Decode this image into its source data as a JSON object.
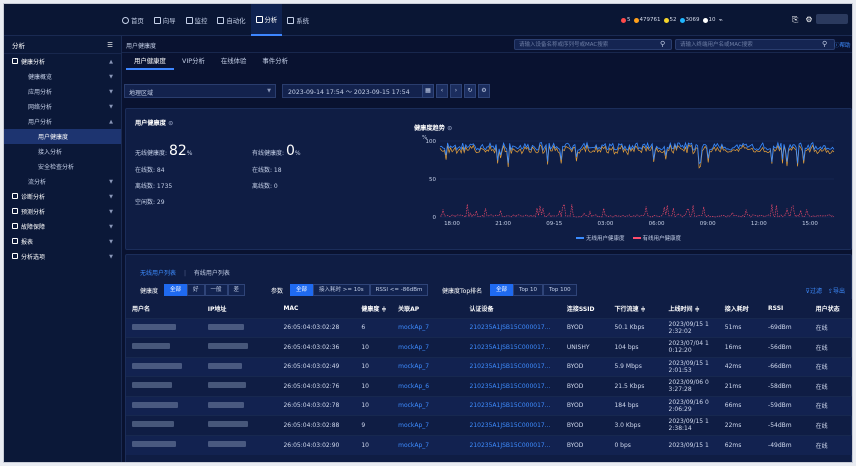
{
  "top_nav": [
    {
      "label": "首页",
      "icon": "home-icon"
    },
    {
      "label": "向导",
      "icon": "compass-icon"
    },
    {
      "label": "监控",
      "icon": "monitor-icon"
    },
    {
      "label": "自动化",
      "icon": "automation-icon"
    },
    {
      "label": "分析",
      "icon": "analysis-icon",
      "active": true
    },
    {
      "label": "系统",
      "icon": "system-icon"
    }
  ],
  "alerts": [
    {
      "count": "5",
      "color": "#ff4a4a"
    },
    {
      "count": "479761",
      "color": "#ff9f1a"
    },
    {
      "count": "52",
      "color": "#f5d42a"
    },
    {
      "count": "3069",
      "color": "#1fb6ff"
    },
    {
      "count": "10",
      "color": "#ffffff"
    }
  ],
  "sidebar": {
    "header": "分析",
    "items": [
      {
        "label": "健康分析",
        "level": 1,
        "group": true
      },
      {
        "label": "健康概览",
        "level": 2
      },
      {
        "label": "应用分析",
        "level": 2
      },
      {
        "label": "网络分析",
        "level": 2
      },
      {
        "label": "用户分析",
        "level": 2
      },
      {
        "label": "用户健康度",
        "level": 3,
        "selected": true
      },
      {
        "label": "接入分析",
        "level": 3
      },
      {
        "label": "安全检查分析",
        "level": 3
      },
      {
        "label": "流分析",
        "level": 2
      },
      {
        "label": "诊断分析",
        "level": 1,
        "group": true
      },
      {
        "label": "预测分析",
        "level": 1,
        "group": true
      },
      {
        "label": "故障保障",
        "level": 1,
        "group": true
      },
      {
        "label": "报表",
        "level": 1,
        "group": true
      },
      {
        "label": "分析选项",
        "level": 1,
        "group": true
      }
    ]
  },
  "breadcrumb": "用户健康度",
  "search1": {
    "placeholder": "请输入设备名称或序列号或MAC搜索"
  },
  "search2": {
    "placeholder": "请输入终端用户名或MAC搜索"
  },
  "help": "帮助",
  "tabs": [
    "用户健康度",
    "VIP分析",
    "在线体验",
    "事件分析"
  ],
  "filter": {
    "area": "地理区域",
    "date_range": "2023-09-14 17:54 ～ 2023-09-15 17:54"
  },
  "health": {
    "title": "用户健康度",
    "wireless_label": "无线健康度:",
    "wireless_value": "82",
    "wired_label": "有线健康度:",
    "wired_value": "0",
    "percent": "%",
    "online_label": "在线数: 84",
    "offline_label": "离线数: 1735",
    "idle_label": "空闲数: 29",
    "wired_online": "在线数: 18",
    "wired_offline": "离线数: 0"
  },
  "trend": {
    "title": "健康度趋势",
    "unit": "%",
    "y_ticks": [
      "100",
      "50",
      "0"
    ],
    "x_ticks": [
      "18:00",
      "21:00",
      "09-15",
      "03:00",
      "06:00",
      "09:00",
      "12:00",
      "15:00"
    ],
    "legend": [
      {
        "name": "无线用户健康度",
        "color": "#3a8cff"
      },
      {
        "name": "有线用户健康度",
        "color": "#ff4d6d"
      }
    ]
  },
  "list": {
    "tab_wireless": "无线用户列表",
    "tab_wired": "有线用户列表",
    "health_label": "健康度",
    "health_opts": [
      "全部",
      "好",
      "一般",
      "差"
    ],
    "param_label": "参数",
    "param_opts": [
      "全部",
      "接入耗时 >= 10s",
      "RSSI <= -86dBm"
    ],
    "top_label": "健康度Top排名",
    "top_opts": [
      "全部",
      "Top 10",
      "Top 100"
    ],
    "filter_btn": "过滤",
    "export_btn": "导出",
    "columns": [
      "用户名",
      "IP地址",
      "MAC",
      "健康度 ≑",
      "关联AP",
      "认证设备",
      "连接SSID",
      "下行流速 ≑",
      "上线时间 ≑",
      "接入耗时",
      "RSSI",
      "用户状态"
    ],
    "rows": [
      {
        "mac": "26:05:04:03:02:28",
        "health": "6",
        "ap": "mockAp_7",
        "auth": "210235A1JSB15C000017...",
        "ssid": "BYOD",
        "down": "50.1 Kbps",
        "time1": "2023/09/15 1",
        "time2": "2:32:02",
        "delay": "51ms",
        "rssi": "-69dBm",
        "status": "在线"
      },
      {
        "mac": "26:05:04:03:02:36",
        "health": "10",
        "ap": "mockAp_7",
        "auth": "210235A1JSB15C000017...",
        "ssid": "UNISHY",
        "down": "104 bps",
        "time1": "2023/07/04 1",
        "time2": "0:12:20",
        "delay": "16ms",
        "rssi": "-56dBm",
        "status": "在线"
      },
      {
        "mac": "26:05:04:03:02:49",
        "health": "10",
        "ap": "mockAp_7",
        "auth": "210235A1JSB15C000017...",
        "ssid": "BYOD",
        "down": "5.9 Mbps",
        "time1": "2023/09/15 1",
        "time2": "2:01:53",
        "delay": "42ms",
        "rssi": "-66dBm",
        "status": "在线"
      },
      {
        "mac": "26:05:04:03:02:76",
        "health": "10",
        "ap": "mockAp_6",
        "auth": "210235A1JSB15C000017...",
        "ssid": "BYOD",
        "down": "21.5 Kbps",
        "time1": "2023/09/06 0",
        "time2": "3:27:28",
        "delay": "21ms",
        "rssi": "-58dBm",
        "status": "在线"
      },
      {
        "mac": "26:05:04:03:02:78",
        "health": "10",
        "ap": "mockAp_7",
        "auth": "210235A1JSB15C000017...",
        "ssid": "BYOD",
        "down": "184 bps",
        "time1": "2023/09/16 0",
        "time2": "2:06:29",
        "delay": "66ms",
        "rssi": "-59dBm",
        "status": "在线"
      },
      {
        "mac": "26:05:04:03:02:88",
        "health": "9",
        "ap": "mockAp_7",
        "auth": "210235A1JSB15C000017...",
        "ssid": "BYOD",
        "down": "3.0 Kbps",
        "time1": "2023/09/15 1",
        "time2": "2:38:14",
        "delay": "22ms",
        "rssi": "-54dBm",
        "status": "在线"
      },
      {
        "mac": "26:05:04:03:02:90",
        "health": "10",
        "ap": "mockAp_7",
        "auth": "210235A1JSB15C000017...",
        "ssid": "BYOD",
        "down": "0 bps",
        "time1": "2023/09/15 1",
        "time2": "",
        "delay": "62ms",
        "rssi": "-49dBm",
        "status": "在线"
      }
    ]
  }
}
